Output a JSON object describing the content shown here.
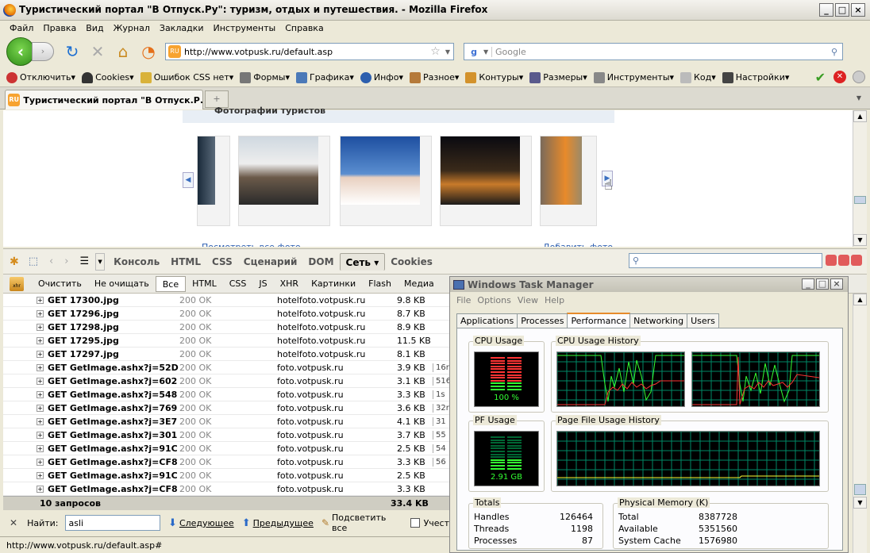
{
  "window": {
    "title": "Туристический портал \"В Отпуск.Ру\": туризм, отдых и путешествия. - Mozilla Firefox"
  },
  "menu": [
    "Файл",
    "Правка",
    "Вид",
    "Журнал",
    "Закладки",
    "Инструменты",
    "Справка"
  ],
  "nav": {
    "url": "http://www.votpusk.ru/default.asp",
    "search_placeholder": "Google"
  },
  "webdev": [
    "Отключить",
    "Cookies",
    "Ошибок CSS нет",
    "Формы",
    "Графика",
    "Инфо",
    "Разное",
    "Контуры",
    "Размеры",
    "Инструменты",
    "Код",
    "Настройки"
  ],
  "tab": {
    "title": "Туристический портал \"В Отпуск.Р..."
  },
  "page": {
    "section": "Фотографии туристов",
    "link_left": "Посмотреть все фото",
    "link_right": "Добавить фото"
  },
  "firebug": {
    "panels": [
      "Консоль",
      "HTML",
      "CSS",
      "Сценарий",
      "DOM",
      "Сеть",
      "Cookies"
    ],
    "active_panel": "Сеть",
    "net_buttons": [
      "Очистить",
      "Не очищать",
      "Все",
      "HTML",
      "CSS",
      "JS",
      "XHR",
      "Картинки",
      "Flash",
      "Медиа"
    ],
    "requests": [
      {
        "url": "GET 17300.jpg",
        "status": "200 OK",
        "domain": "hotelfoto.votpusk.ru",
        "size": "9.8 KB",
        "time": ""
      },
      {
        "url": "GET 17296.jpg",
        "status": "200 OK",
        "domain": "hotelfoto.votpusk.ru",
        "size": "8.7 KB",
        "time": ""
      },
      {
        "url": "GET 17298.jpg",
        "status": "200 OK",
        "domain": "hotelfoto.votpusk.ru",
        "size": "8.9 KB",
        "time": ""
      },
      {
        "url": "GET 17295.jpg",
        "status": "200 OK",
        "domain": "hotelfoto.votpusk.ru",
        "size": "11.5 KB",
        "time": ""
      },
      {
        "url": "GET 17297.jpg",
        "status": "200 OK",
        "domain": "hotelfoto.votpusk.ru",
        "size": "8.1 KB",
        "time": ""
      },
      {
        "url": "GET GetImage.ashx?j=52D",
        "status": "200 OK",
        "domain": "foto.votpusk.ru",
        "size": "3.9 KB",
        "time": "16r"
      },
      {
        "url": "GET GetImage.ashx?j=602",
        "status": "200 OK",
        "domain": "foto.votpusk.ru",
        "size": "3.1 KB",
        "time": "516"
      },
      {
        "url": "GET GetImage.ashx?j=548",
        "status": "200 OK",
        "domain": "foto.votpusk.ru",
        "size": "3.3 KB",
        "time": "1s"
      },
      {
        "url": "GET GetImage.ashx?j=769",
        "status": "200 OK",
        "domain": "foto.votpusk.ru",
        "size": "3.6 KB",
        "time": "32r"
      },
      {
        "url": "GET GetImage.ashx?j=3E7",
        "status": "200 OK",
        "domain": "foto.votpusk.ru",
        "size": "4.1 KB",
        "time": "31"
      },
      {
        "url": "GET GetImage.ashx?j=301",
        "status": "200 OK",
        "domain": "foto.votpusk.ru",
        "size": "3.7 KB",
        "time": "55"
      },
      {
        "url": "GET GetImage.ashx?j=91C",
        "status": "200 OK",
        "domain": "foto.votpusk.ru",
        "size": "2.5 KB",
        "time": "54"
      },
      {
        "url": "GET GetImage.ashx?j=CF8",
        "status": "200 OK",
        "domain": "foto.votpusk.ru",
        "size": "3.3 KB",
        "time": "56"
      },
      {
        "url": "GET GetImage.ashx?j=91C",
        "status": "200 OK",
        "domain": "foto.votpusk.ru",
        "size": "2.5 KB",
        "time": ""
      },
      {
        "url": "GET GetImage.ashx?j=CF8",
        "status": "200 OK",
        "domain": "foto.votpusk.ru",
        "size": "3.3 KB",
        "time": ""
      }
    ],
    "summary": {
      "count": "10 запросов",
      "total": "33.4 KB"
    },
    "find": {
      "label": "Найти:",
      "value": "asli",
      "next": "Следующее",
      "prev": "Предыдущее",
      "highlight": "Подсветить все",
      "case": "Учест"
    }
  },
  "status": "http://www.votpusk.ru/default.asp#",
  "taskmgr": {
    "title": "Windows Task Manager",
    "menu": [
      "File",
      "Options",
      "View",
      "Help"
    ],
    "tabs": [
      "Applications",
      "Processes",
      "Performance",
      "Networking",
      "Users"
    ],
    "active_tab": "Performance",
    "cpu_label": "CPU Usage",
    "cpu_value": "100 %",
    "cpu_level": 1.0,
    "cpu_hist_label": "CPU Usage History",
    "pf_label": "PF Usage",
    "pf_value": "2.91 GB",
    "pf_level": 0.35,
    "pf_hist_label": "Page File Usage History",
    "totals": {
      "title": "Totals",
      "rows": [
        [
          "Handles",
          "126464"
        ],
        [
          "Threads",
          "1198"
        ],
        [
          "Processes",
          "87"
        ]
      ]
    },
    "physmem": {
      "title": "Physical Memory (K)",
      "rows": [
        [
          "Total",
          "8387728"
        ],
        [
          "Available",
          "5351560"
        ],
        [
          "System Cache",
          "1576980"
        ]
      ]
    }
  }
}
